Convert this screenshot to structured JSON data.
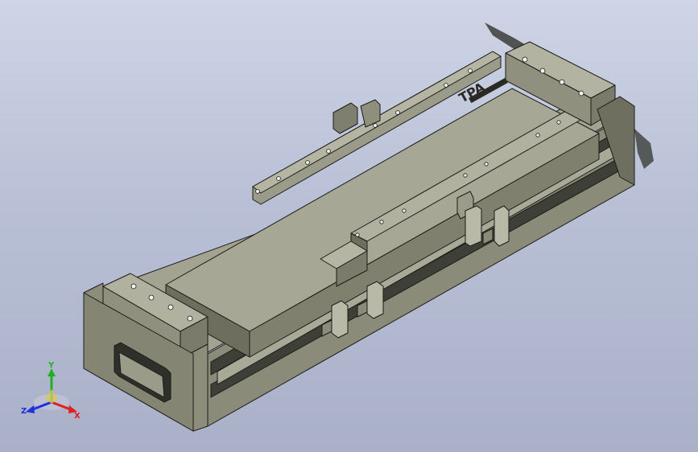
{
  "viewport": {
    "background_top": "#cfd5e6",
    "background_bottom": "#a9b0c8"
  },
  "model": {
    "logo_text": "TPA",
    "body_color": "#8e8f7c",
    "top_color": "#a4a592",
    "dark_color": "#5e5f52",
    "edge_color": "#1c1c18"
  },
  "triad": {
    "x_label": "X",
    "y_label": "Y",
    "z_label": "Z",
    "x_color": "#e02020",
    "y_color": "#20b020",
    "z_color": "#2030e0"
  }
}
